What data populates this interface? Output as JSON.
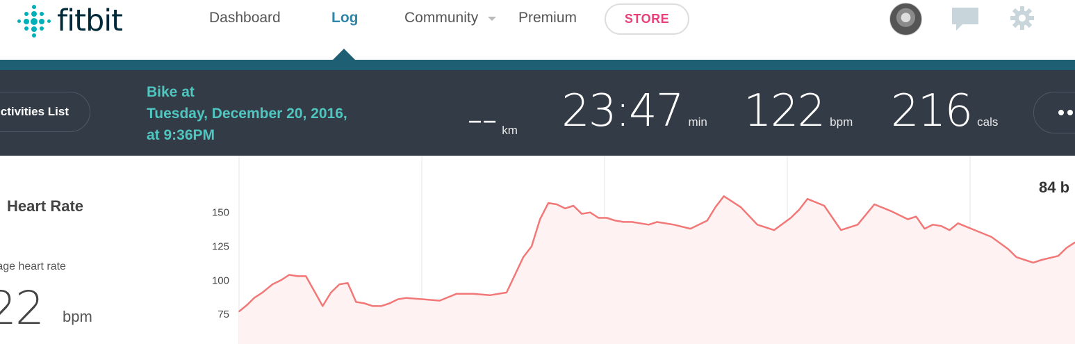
{
  "nav": {
    "brand": "fitbit",
    "links": [
      "Dashboard",
      "Log",
      "Community",
      "Premium"
    ],
    "active": "Log",
    "store": "STORE",
    "colors": {
      "accent": "#2f86a8",
      "store": "#e7407a",
      "teal": "#1f5f73"
    }
  },
  "activity": {
    "back_label": "ctivities List",
    "title_line1": "Bike at",
    "title_line2": "Tuesday, December 20, 2016,",
    "title_line3": "at 9:36PM",
    "distance": "--",
    "distance_unit": "km",
    "duration": "23:47",
    "duration_unit": "min",
    "heart_rate": "122",
    "heart_rate_unit": "bpm",
    "calories": "216",
    "calories_unit": "cals"
  },
  "heart_rate": {
    "title": "Heart Rate",
    "avg_label": "rage heart rate",
    "avg_value": "22",
    "avg_unit": "bpm",
    "peak_label": "84 b"
  },
  "chart_data": {
    "type": "area",
    "yticks": [
      75,
      100,
      125,
      150
    ],
    "ylim": [
      53,
      176
    ],
    "xlim": [
      0,
      100
    ],
    "grid": true,
    "line_color": "#f27878",
    "fill_color": "#fff2f2",
    "x": [
      0,
      1,
      1.8,
      2.8,
      4,
      5,
      6,
      7,
      8,
      9,
      10,
      11,
      12,
      13,
      14,
      15,
      16,
      17,
      18,
      19,
      20,
      22,
      24,
      26,
      28,
      30,
      32,
      34,
      35,
      36,
      37,
      38,
      39,
      40,
      41,
      42,
      43,
      44,
      45,
      46,
      47,
      48,
      49,
      50,
      52,
      54,
      56,
      57,
      58,
      60,
      62,
      64,
      66,
      67,
      68,
      70,
      72,
      74,
      76,
      78,
      80,
      81,
      82,
      83,
      84,
      85,
      86,
      88,
      90,
      92,
      93,
      94,
      95,
      96,
      98,
      99,
      100
    ],
    "values": [
      77,
      82,
      87,
      91,
      97,
      100,
      104,
      103,
      103,
      92,
      81,
      91,
      97,
      98,
      84,
      83,
      81,
      81,
      83,
      86,
      87,
      86,
      85,
      90,
      90,
      89,
      91,
      117,
      125,
      145,
      157,
      156,
      153,
      155,
      149,
      150,
      146,
      146,
      144,
      143,
      143,
      142,
      141,
      143,
      141,
      138,
      144,
      154,
      162,
      154,
      141,
      137,
      146,
      152,
      160,
      155,
      137,
      141,
      156,
      151,
      145,
      147,
      138,
      141,
      140,
      137,
      142,
      137,
      132,
      123,
      117,
      115,
      113,
      115,
      118,
      124,
      128
    ]
  }
}
